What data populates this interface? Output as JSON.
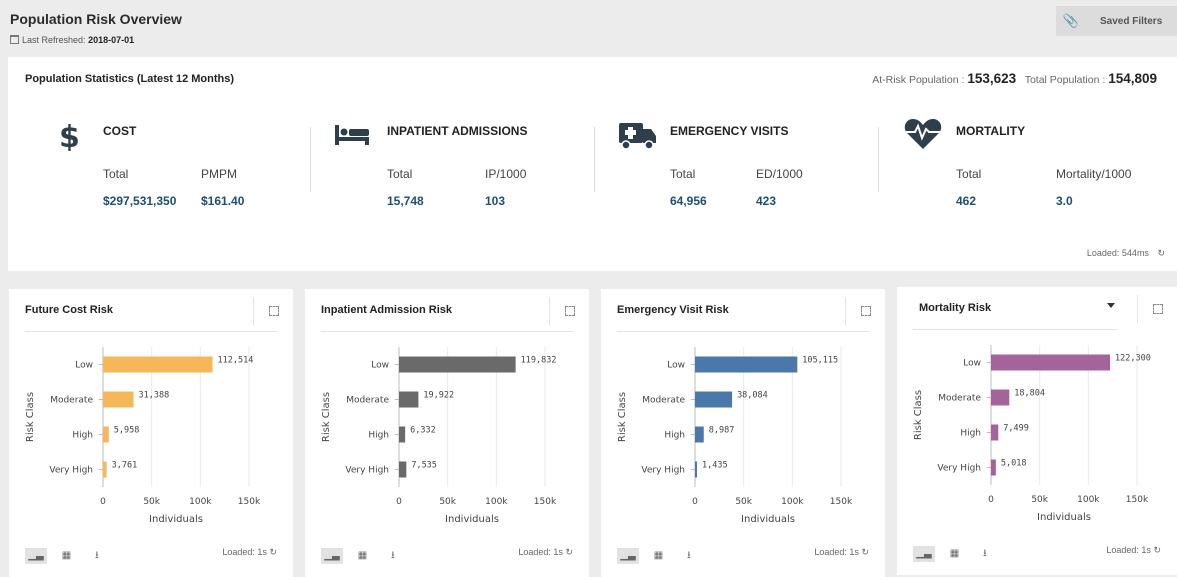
{
  "header": {
    "title": "Population Risk Overview",
    "refreshed_label": "Last Refreshed:",
    "refreshed_date": "2018-07-01",
    "saved_filters_label": "Saved Filters"
  },
  "stats": {
    "title": "Population Statistics (Latest 12 Months)",
    "at_risk_label": "At-Risk Population :",
    "at_risk_value": "153,623",
    "total_label": "Total Population :",
    "total_value": "154,809",
    "loaded": "Loaded: 544ms",
    "metrics": [
      {
        "title": "COST",
        "icon": "dollar-icon",
        "sub1": "Total",
        "sub2": "PMPM",
        "val1": "$297,531,350",
        "val2": "$161.40"
      },
      {
        "title": "INPATIENT ADMISSIONS",
        "icon": "bed-icon",
        "sub1": "Total",
        "sub2": "IP/1000",
        "val1": "15,748",
        "val2": "103"
      },
      {
        "title": "EMERGENCY VISITS",
        "icon": "ambulance-icon",
        "sub1": "Total",
        "sub2": "ED/1000",
        "val1": "64,956",
        "val2": "423"
      },
      {
        "title": "MORTALITY",
        "icon": "heartbeat-icon",
        "sub1": "Total",
        "sub2": "Mortality/1000",
        "val1": "462",
        "val2": "3.0"
      }
    ]
  },
  "cards": [
    {
      "title": "Future Cost Risk",
      "loaded": "Loaded: 1s",
      "dropdown": false
    },
    {
      "title": "Inpatient Admission Risk",
      "loaded": "Loaded: 1s",
      "dropdown": false
    },
    {
      "title": "Emergency Visit Risk",
      "loaded": "Loaded: 1s",
      "dropdown": false
    },
    {
      "title": "Mortality Risk",
      "loaded": "Loaded: 1s",
      "dropdown": true
    }
  ],
  "chart_data": [
    {
      "type": "bar",
      "orientation": "horizontal",
      "categories": [
        "Low",
        "Moderate",
        "High",
        "Very High"
      ],
      "values": [
        112514,
        31388,
        5958,
        3761
      ],
      "labels": [
        "112,514",
        "31,388",
        "5,958",
        "3,761"
      ],
      "ylabel": "Risk Class",
      "xlabel": "Individuals",
      "xlim": [
        0,
        150000
      ],
      "xticks": [
        "0",
        "50k",
        "100k",
        "150k"
      ],
      "color": "#f5b75a"
    },
    {
      "type": "bar",
      "orientation": "horizontal",
      "categories": [
        "Low",
        "Moderate",
        "High",
        "Very High"
      ],
      "values": [
        119832,
        19922,
        6332,
        7535
      ],
      "labels": [
        "119,832",
        "19,922",
        "6,332",
        "7,535"
      ],
      "ylabel": "Risk Class",
      "xlabel": "Individuals",
      "xlim": [
        0,
        150000
      ],
      "xticks": [
        "0",
        "50k",
        "100k",
        "150k"
      ],
      "color": "#6a6a6a"
    },
    {
      "type": "bar",
      "orientation": "horizontal",
      "categories": [
        "Low",
        "Moderate",
        "High",
        "Very High"
      ],
      "values": [
        105115,
        38084,
        8987,
        1435
      ],
      "labels": [
        "105,115",
        "38,084",
        "8,987",
        "1,435"
      ],
      "ylabel": "Risk Class",
      "xlabel": "Individuals",
      "xlim": [
        0,
        150000
      ],
      "xticks": [
        "0",
        "50k",
        "100k",
        "150k"
      ],
      "color": "#4a78a8"
    },
    {
      "type": "bar",
      "orientation": "horizontal",
      "categories": [
        "Low",
        "Moderate",
        "High",
        "Very High"
      ],
      "values": [
        122300,
        18804,
        7499,
        5018
      ],
      "labels": [
        "122,300",
        "18,804",
        "7,499",
        "5,018"
      ],
      "ylabel": "Risk Class",
      "xlabel": "Individuals",
      "xlim": [
        0,
        150000
      ],
      "xticks": [
        "0",
        "50k",
        "100k",
        "150k"
      ],
      "color": "#a4649a"
    }
  ]
}
